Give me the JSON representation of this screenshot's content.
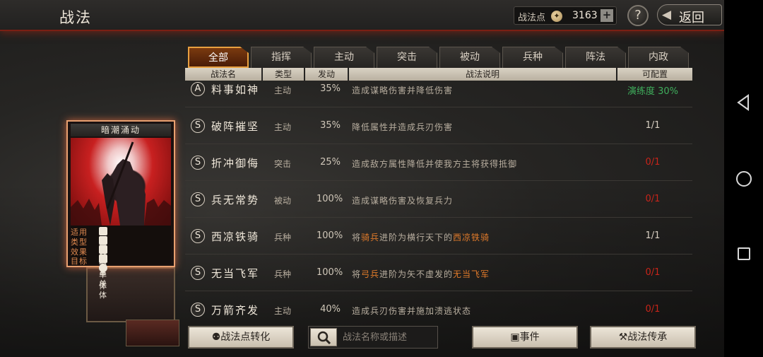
{
  "header": {
    "title": "战法",
    "points_label": "战法点",
    "points_value": "3163",
    "help": "?",
    "back_label": "返回"
  },
  "tabs": [
    {
      "label": "全部",
      "active": true
    },
    {
      "label": "指挥",
      "active": false
    },
    {
      "label": "主动",
      "active": false
    },
    {
      "label": "突击",
      "active": false
    },
    {
      "label": "被动",
      "active": false
    },
    {
      "label": "兵种",
      "active": false
    },
    {
      "label": "阵法",
      "active": false
    },
    {
      "label": "内政",
      "active": false
    }
  ],
  "columns": [
    "战法名",
    "类型",
    "发动",
    "战法说明",
    "可配置"
  ],
  "rows": [
    {
      "grade": "A",
      "name": "料事如神",
      "type": "主动",
      "rate": "35%",
      "desc": "造成谋略伤害并降低伤害",
      "config": "演练度 30%",
      "config_style": "green"
    },
    {
      "grade": "S",
      "name": "破阵摧坚",
      "type": "主动",
      "rate": "35%",
      "desc": "降低属性并造成兵刃伤害",
      "config": "1/1",
      "config_style": "normal"
    },
    {
      "grade": "S",
      "name": "折冲御侮",
      "type": "突击",
      "rate": "25%",
      "desc": "造成敌方属性降低并使我方主将获得抵御",
      "config": "0/1",
      "config_style": "red"
    },
    {
      "grade": "S",
      "name": "兵无常势",
      "type": "被动",
      "rate": "100%",
      "desc": "造成谋略伤害及恢复兵力",
      "config": "0/1",
      "config_style": "red"
    },
    {
      "grade": "S",
      "name": "西凉铁骑",
      "type": "兵种",
      "rate": "100%",
      "desc_parts": [
        "将",
        "骑兵",
        "进阶为横行天下的",
        "西凉铁骑"
      ],
      "config": "1/1",
      "config_style": "normal"
    },
    {
      "grade": "S",
      "name": "无当飞军",
      "type": "兵种",
      "rate": "100%",
      "desc_parts": [
        "将",
        "弓兵",
        "进阶为矢不虚发的",
        "无当飞军"
      ],
      "config": "0/1",
      "config_style": "red"
    },
    {
      "grade": "S",
      "name": "万箭齐发",
      "type": "主动",
      "rate": "40%",
      "desc": "造成兵刃伤害并施加溃逃状态",
      "config": "0/1",
      "config_style": "red"
    }
  ],
  "card": {
    "title": "暗潮涌动",
    "info": [
      {
        "key": "适用",
        "icons": [
          "cavalry-icon",
          "shield-icon",
          "crossbow-icon",
          "spear-icon",
          "wheel-icon"
        ]
      },
      {
        "key": "类型",
        "value": "主动"
      },
      {
        "key": "效果",
        "value": "兵刃单体"
      },
      {
        "key": "目标",
        "value": "敌军单体"
      }
    ]
  },
  "bottom": {
    "convert_label": "战法点转化",
    "search_placeholder": "战法名称或描述",
    "event_label": "事件",
    "inherit_label": "战法传承"
  },
  "colors": {
    "accent_orange": "#e07a2a",
    "config_red": "#c8241a",
    "config_green": "#3fae5c",
    "tab_active_border": "#e8a040"
  }
}
